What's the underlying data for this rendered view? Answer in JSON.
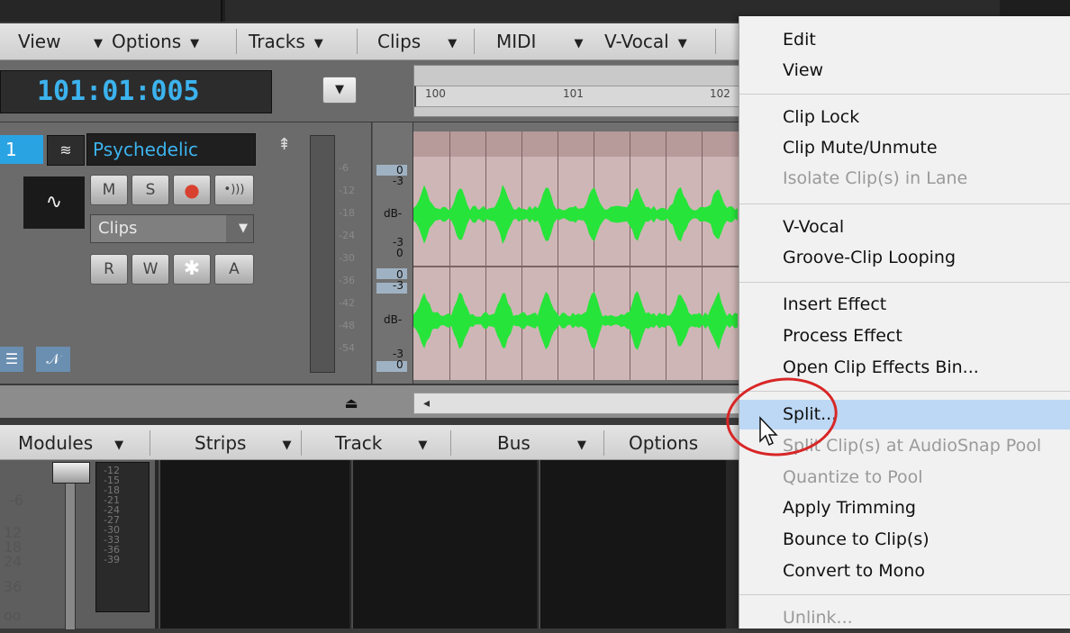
{
  "menubar": [
    {
      "label": "View",
      "arrow": "▼"
    },
    {
      "label": "Options",
      "arrow": "▼"
    },
    {
      "label": "Tracks",
      "arrow": "▼"
    },
    {
      "label": "Clips",
      "arrow": "▼"
    },
    {
      "label": "MIDI",
      "arrow": "▼"
    },
    {
      "label": "V-Vocal",
      "arrow": "▼"
    }
  ],
  "transport": {
    "timecode": "101:01:005",
    "ruler_ticks": [
      "100",
      "101",
      "102"
    ]
  },
  "track": {
    "number": "1",
    "name": "Psychedelic",
    "buttons": [
      "M",
      "S",
      "●",
      "•)))"
    ],
    "buttons2": [
      "R",
      "W",
      "✱",
      "A"
    ],
    "clips_dropdown": "Clips",
    "meter_ticks": [
      "-6",
      "-12",
      "-18",
      "-24",
      "-30",
      "-36",
      "-42",
      "-48",
      "-54"
    ]
  },
  "db_labels": {
    "lane1": [
      "0",
      "-3",
      "dB-",
      "-3",
      "0"
    ],
    "lane2": [
      "0",
      "-3",
      "dB-",
      "-3",
      "0"
    ]
  },
  "console": {
    "headers": [
      {
        "label": "Modules",
        "arrow": "▼"
      },
      {
        "label": "Strips",
        "arrow": "▼"
      },
      {
        "label": "Track",
        "arrow": "▼"
      },
      {
        "label": "Bus",
        "arrow": "▼"
      },
      {
        "label": "Options"
      }
    ],
    "fader_ticks": [
      "-6",
      "12",
      "18",
      "24",
      "36",
      "oo"
    ],
    "meter_ticks": [
      "-12",
      "-15",
      "-18",
      "-21",
      "-24",
      "-27",
      "-30",
      "-33",
      "-36",
      "-39"
    ]
  },
  "context_menu": {
    "items": [
      {
        "label": "Edit",
        "disabled": false
      },
      {
        "label": "View",
        "disabled": false
      },
      {
        "label": "Clip Lock",
        "disabled": false
      },
      {
        "label": "Clip Mute/Unmute",
        "disabled": false
      },
      {
        "label": "Isolate Clip(s) in Lane",
        "disabled": true
      },
      {
        "label": "V-Vocal",
        "disabled": false
      },
      {
        "label": "Groove-Clip Looping",
        "disabled": false
      },
      {
        "label": "Insert Effect",
        "disabled": false
      },
      {
        "label": "Process Effect",
        "disabled": false
      },
      {
        "label": "Open Clip Effects Bin...",
        "disabled": false
      },
      {
        "label": "Split...",
        "disabled": false,
        "highlighted": true
      },
      {
        "label": "Split Clip(s) at AudioSnap Pool",
        "disabled": true
      },
      {
        "label": "Quantize to Pool",
        "disabled": true
      },
      {
        "label": "Apply Trimming",
        "disabled": false
      },
      {
        "label": "Bounce to Clip(s)",
        "disabled": false
      },
      {
        "label": "Convert to Mono",
        "disabled": false
      },
      {
        "label": "Unlink...",
        "disabled": true
      }
    ]
  },
  "colors": {
    "accent_blue": "#3cb3ee",
    "waveform": "#27e43a",
    "clip_bg": "#cfb6b6",
    "menu_highlight": "#bdd8f4",
    "annotation_circle": "#d82626",
    "record_red": "#d8412f"
  }
}
